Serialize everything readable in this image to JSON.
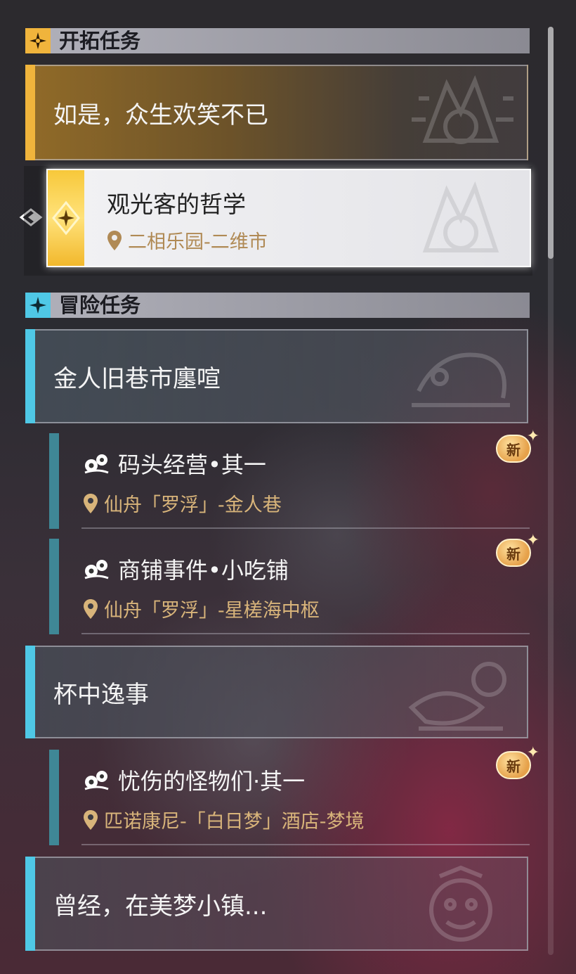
{
  "sections": {
    "trailblaze": {
      "header": "开拓任务",
      "quest_group": "如是，众生欢笑不已",
      "active_quest": {
        "name": "观光客的哲学",
        "location": "二相乐园-二维市"
      }
    },
    "adventure": {
      "header": "冒险任务",
      "groups": [
        {
          "title": "金人旧巷市廛喧",
          "quests": [
            {
              "name": "码头经营•其一",
              "location": "仙舟「罗浮」-金人巷",
              "badge": "新"
            },
            {
              "name": "商铺事件•小吃铺",
              "location": "仙舟「罗浮」-星槎海中枢",
              "badge": "新"
            }
          ]
        },
        {
          "title": "杯中逸事",
          "quests": [
            {
              "name": "忧伤的怪物们·其一",
              "location": "匹诺康尼-「白日梦」酒店-梦境",
              "badge": "新"
            }
          ]
        },
        {
          "title": "曾经，在美梦小镇...",
          "quests": []
        }
      ]
    }
  },
  "colors": {
    "trailblaze_accent": "#f0b43c",
    "adventure_accent": "#4fc8e6",
    "location_text": "#d8b47a",
    "sub_bar": "#3f8796"
  },
  "icons": {
    "trailblaze_header": "compass-star-icon",
    "adventure_header": "four-point-star-icon",
    "quest_type": "companion-quest-icon",
    "location": "map-pin-icon",
    "selector": "selector-arrow-icon"
  }
}
